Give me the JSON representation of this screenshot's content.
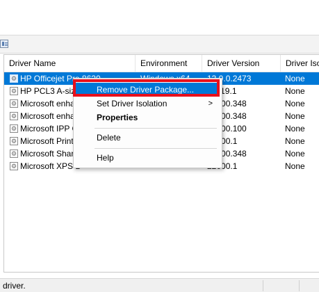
{
  "columns": [
    "Driver Name",
    "Environment",
    "Driver Version",
    "Driver Isol"
  ],
  "rows": [
    {
      "name": "HP Officejet Pro 8620",
      "environment": "Windows x64",
      "version": "13.0.0.2473",
      "isolation": "None",
      "selected": true
    },
    {
      "name": "HP PCL3 A-size",
      "environment": "",
      "version": "17119.1",
      "isolation": "None"
    },
    {
      "name": "Microsoft enha",
      "environment": "",
      "version": "22000.348",
      "isolation": "None"
    },
    {
      "name": "Microsoft enha",
      "environment": "",
      "version": "22000.348",
      "isolation": "None"
    },
    {
      "name": "Microsoft IPP C",
      "environment": "",
      "version": "22000.100",
      "isolation": "None"
    },
    {
      "name": "Microsoft Print",
      "environment": "",
      "version": "22000.1",
      "isolation": "None"
    },
    {
      "name": "Microsoft Share",
      "environment": "",
      "version": "22000.348",
      "isolation": "None"
    },
    {
      "name": "Microsoft XPS D",
      "environment": "",
      "version": "22000.1",
      "isolation": "None"
    }
  ],
  "context_menu": {
    "remove_driver_package": "Remove Driver Package...",
    "set_driver_isolation": "Set Driver Isolation",
    "submenu_arrow": ">",
    "properties": "Properties",
    "delete": "Delete",
    "help": "Help"
  },
  "status_bar": {
    "text": "driver."
  },
  "colors": {
    "selection": "#0078d7",
    "highlight_box": "#e8101c"
  }
}
